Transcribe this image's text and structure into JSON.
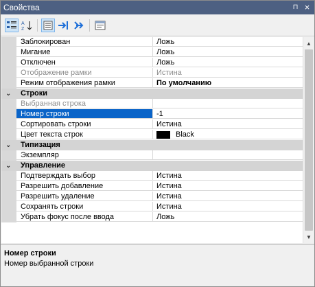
{
  "window": {
    "title": "Свойства"
  },
  "titlebar": {
    "pin_glyph": "⊓",
    "close_glyph": "×"
  },
  "grid": {
    "rows_top": [
      {
        "label": "Заблокирован",
        "value": "Ложь"
      },
      {
        "label": "Мигание",
        "value": "Ложь"
      },
      {
        "label": "Отключен",
        "value": "Ложь"
      },
      {
        "label": "Отображение рамки",
        "value": "Истина",
        "disabled": true
      },
      {
        "label": "Режим отображения рамки",
        "value": "По умолчанию",
        "bold_value": true
      }
    ],
    "categories": [
      {
        "label": "Строки"
      },
      {
        "label": "Типизация"
      },
      {
        "label": "Управление"
      }
    ],
    "rows_strings": [
      {
        "label": "Выбранная строка",
        "value": "",
        "disabled": true
      },
      {
        "label": "Номер строки",
        "value": "-1",
        "selected": true
      },
      {
        "label": "Сортировать строки",
        "value": "Истина"
      },
      {
        "label": "Цвет текста строк",
        "value": "Black",
        "swatch": "#000000"
      }
    ],
    "rows_typing": [
      {
        "label": "Экземпляр",
        "value": ""
      }
    ],
    "rows_control": [
      {
        "label": "Подтверждать выбор",
        "value": "Истина"
      },
      {
        "label": "Разрешить добавление",
        "value": "Истина"
      },
      {
        "label": "Разрешить удаление",
        "value": "Истина"
      },
      {
        "label": "Сохранять строки",
        "value": "Истина"
      },
      {
        "label": "Убрать фокус после ввода",
        "value": "Ложь"
      }
    ]
  },
  "description": {
    "title": "Номер строки",
    "text": "Номер выбранной строки"
  },
  "colors": {
    "selection": "#0a64c8",
    "titlebar": "#4d6082",
    "category": "#d4d4d4"
  }
}
